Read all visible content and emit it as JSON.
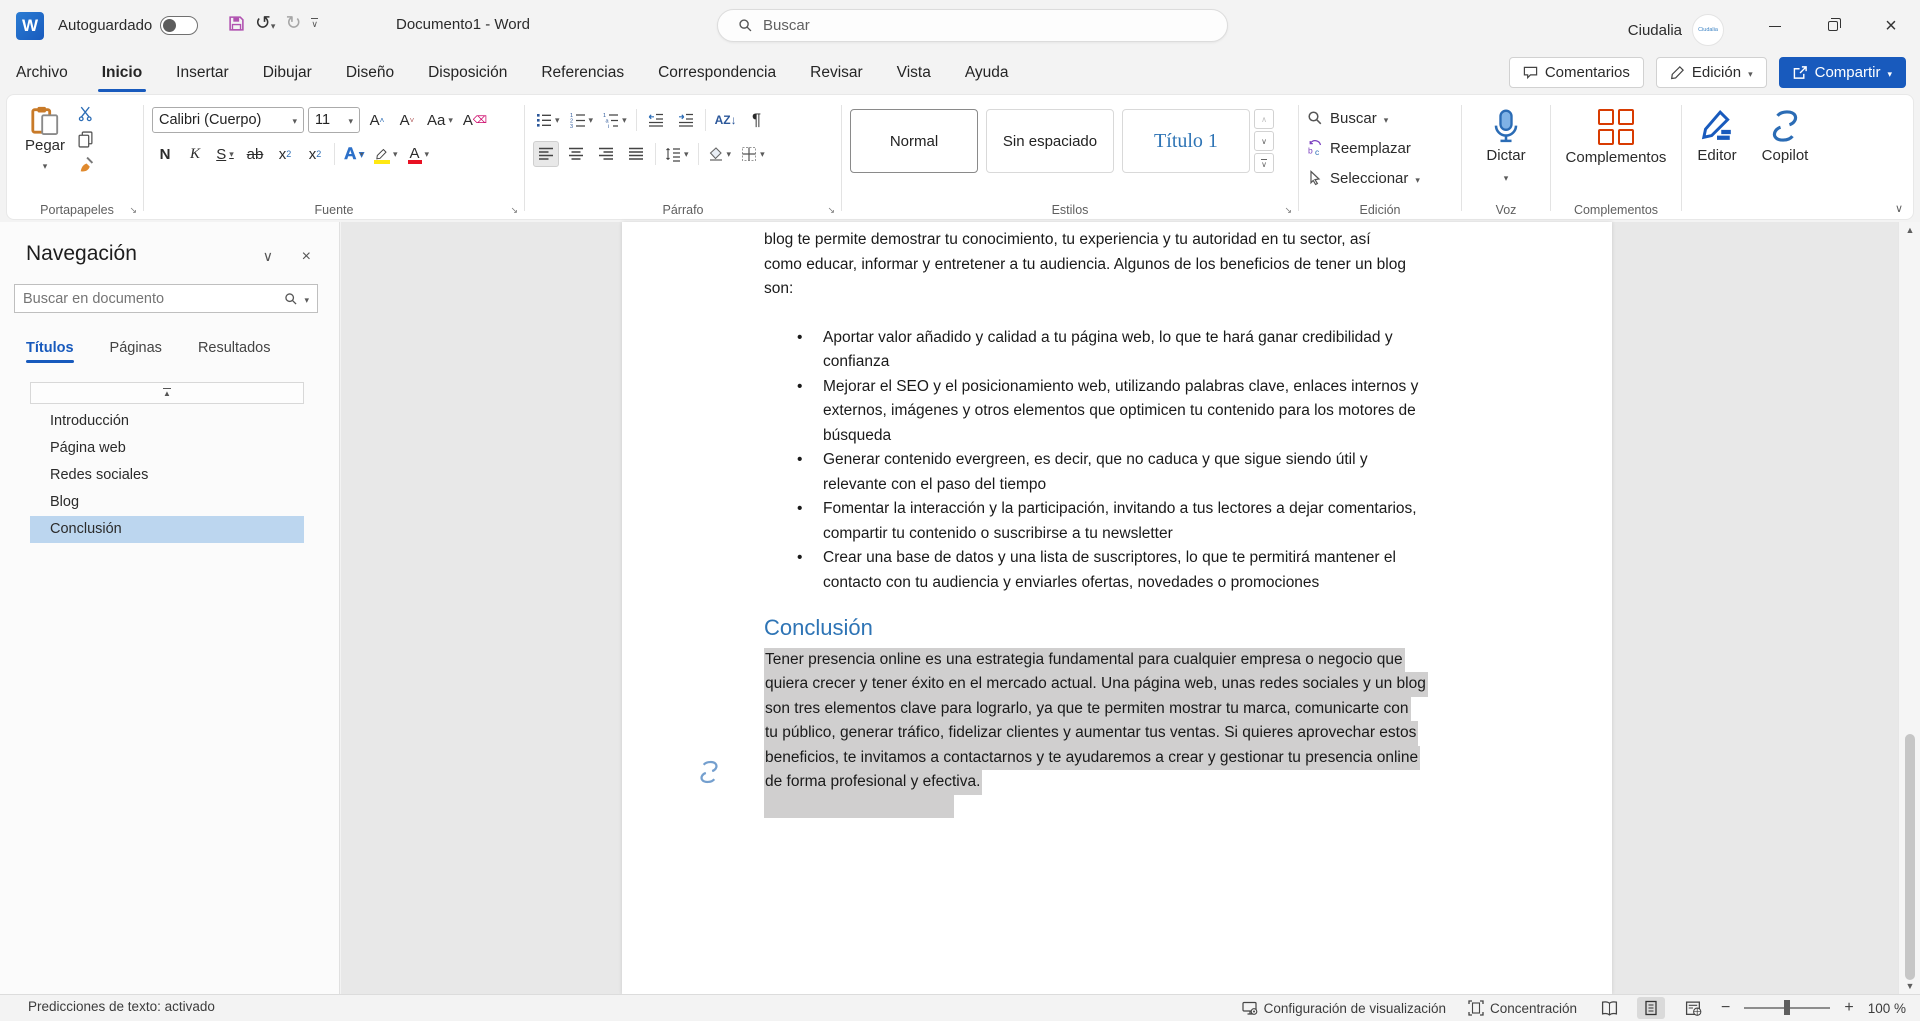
{
  "colors": {
    "accent_blue": "#185abd",
    "heading_blue": "#2e74b5",
    "selection_gray": "#d0cfcf",
    "nav_selected_blue": "#bcd6ef",
    "addins_orange": "#d83b01",
    "save_magenta": "#b052b0",
    "highlight_yellow": "#ffe812",
    "font_color_red": "#e81123"
  },
  "icons": {
    "word_logo": "W",
    "undo": "↺",
    "redo": "↻",
    "dropdown_arrow": "▾",
    "chevron_down": "∨",
    "chevron_up": "∧",
    "close": "✕",
    "pilcrow": "¶",
    "scroll_up": "▲",
    "scroll_down": "▼",
    "zoom_minus": "−",
    "zoom_plus": "+",
    "launcher": "↘"
  },
  "titlebar": {
    "autosave_label": "Autoguardado",
    "autosave_state": "off",
    "doc_title": "Documento1  -  Word",
    "search_placeholder": "Buscar",
    "user_name": "Ciudalia",
    "avatar_text": "Ciudalia"
  },
  "tabs": {
    "items": [
      "Archivo",
      "Inicio",
      "Insertar",
      "Dibujar",
      "Diseño",
      "Disposición",
      "Referencias",
      "Correspondencia",
      "Revisar",
      "Vista",
      "Ayuda"
    ],
    "active": "Inicio"
  },
  "actions": {
    "comments": "Comentarios",
    "editing_mode": "Edición",
    "share": "Compartir"
  },
  "ribbon": {
    "paste": "Pegar",
    "font_name": "Calibri (Cuerpo)",
    "font_size": "11",
    "font_buttons": {
      "bold": "N",
      "italic": "K",
      "underline": "S",
      "strikethrough": "ab",
      "subscript_base": "x",
      "subscript_mark": "2",
      "superscript_base": "x",
      "superscript_mark": "2",
      "grow": "A",
      "shrink": "A",
      "change_case": "Aa",
      "clear_format": "A",
      "text_effects": "A",
      "font_color": "A",
      "sort": "AZ↓",
      "pilcrow": "¶"
    },
    "groups": {
      "clipboard": "Portapapeles",
      "font": "Fuente",
      "paragraph": "Párrafo",
      "styles": "Estilos",
      "editing": "Edición",
      "voice": "Voz",
      "addins": "Complementos"
    },
    "styles": [
      "Normal",
      "Sin espaciado",
      "Título 1"
    ],
    "styles_selected": "Normal",
    "editing": {
      "find": "Buscar",
      "replace": "Reemplazar",
      "select": "Seleccionar"
    },
    "dictate": "Dictar",
    "addins_button": "Complementos",
    "editor": "Editor",
    "copilot": "Copilot"
  },
  "navigation": {
    "title": "Navegación",
    "search_placeholder": "Buscar en documento",
    "tabs": [
      "Títulos",
      "Páginas",
      "Resultados"
    ],
    "active_tab": "Títulos",
    "items": [
      "Introducción",
      "Página web",
      "Redes sociales",
      "Blog",
      "Conclusión"
    ],
    "selected_item": "Conclusión"
  },
  "document": {
    "intro_lines": [
      "blog te permite demostrar tu conocimiento, tu experiencia y tu autoridad en tu sector, así",
      "como educar, informar y entretener a tu audiencia. Algunos de los beneficios de tener un blog",
      "son:"
    ],
    "bullets": [
      [
        "Aportar valor añadido y calidad a tu página web, lo que te hará ganar credibilidad y",
        "confianza"
      ],
      [
        "Mejorar el SEO y el posicionamiento web, utilizando palabras clave, enlaces internos y",
        "externos, imágenes y otros elementos que optimicen tu contenido para los motores de",
        "búsqueda"
      ],
      [
        "Generar contenido evergreen, es decir, que no caduca y que sigue siendo útil y",
        "relevante con el paso del tiempo"
      ],
      [
        "Fomentar la interacción y la participación, invitando a tus lectores a dejar comentarios,",
        "compartir tu contenido o suscribirse a tu newsletter"
      ],
      [
        "Crear una base de datos y una lista de suscriptores, lo que te permitirá mantener el",
        "contacto con tu audiencia y enviarles ofertas, novedades o promociones"
      ]
    ],
    "heading": "Conclusión",
    "conclusion_lines": [
      "Tener presencia online es una estrategia fundamental para cualquier empresa o negocio que",
      "quiera crecer y tener éxito en el mercado actual. Una página web, unas redes sociales y un blog",
      "son tres elementos clave para lograrlo, ya que te permiten mostrar tu marca, comunicarte con",
      "tu público, generar tráfico, fidelizar clientes y aumentar tus ventas. Si quieres aprovechar estos",
      "beneficios, te invitamos a contactarnos y te ayudaremos a crear y gestionar tu presencia online",
      "de forma profesional y efectiva."
    ]
  },
  "statusbar": {
    "left": "Predicciones de texto: activado",
    "display_settings": "Configuración de visualización",
    "focus": "Concentración",
    "zoom_level": "100 %"
  }
}
